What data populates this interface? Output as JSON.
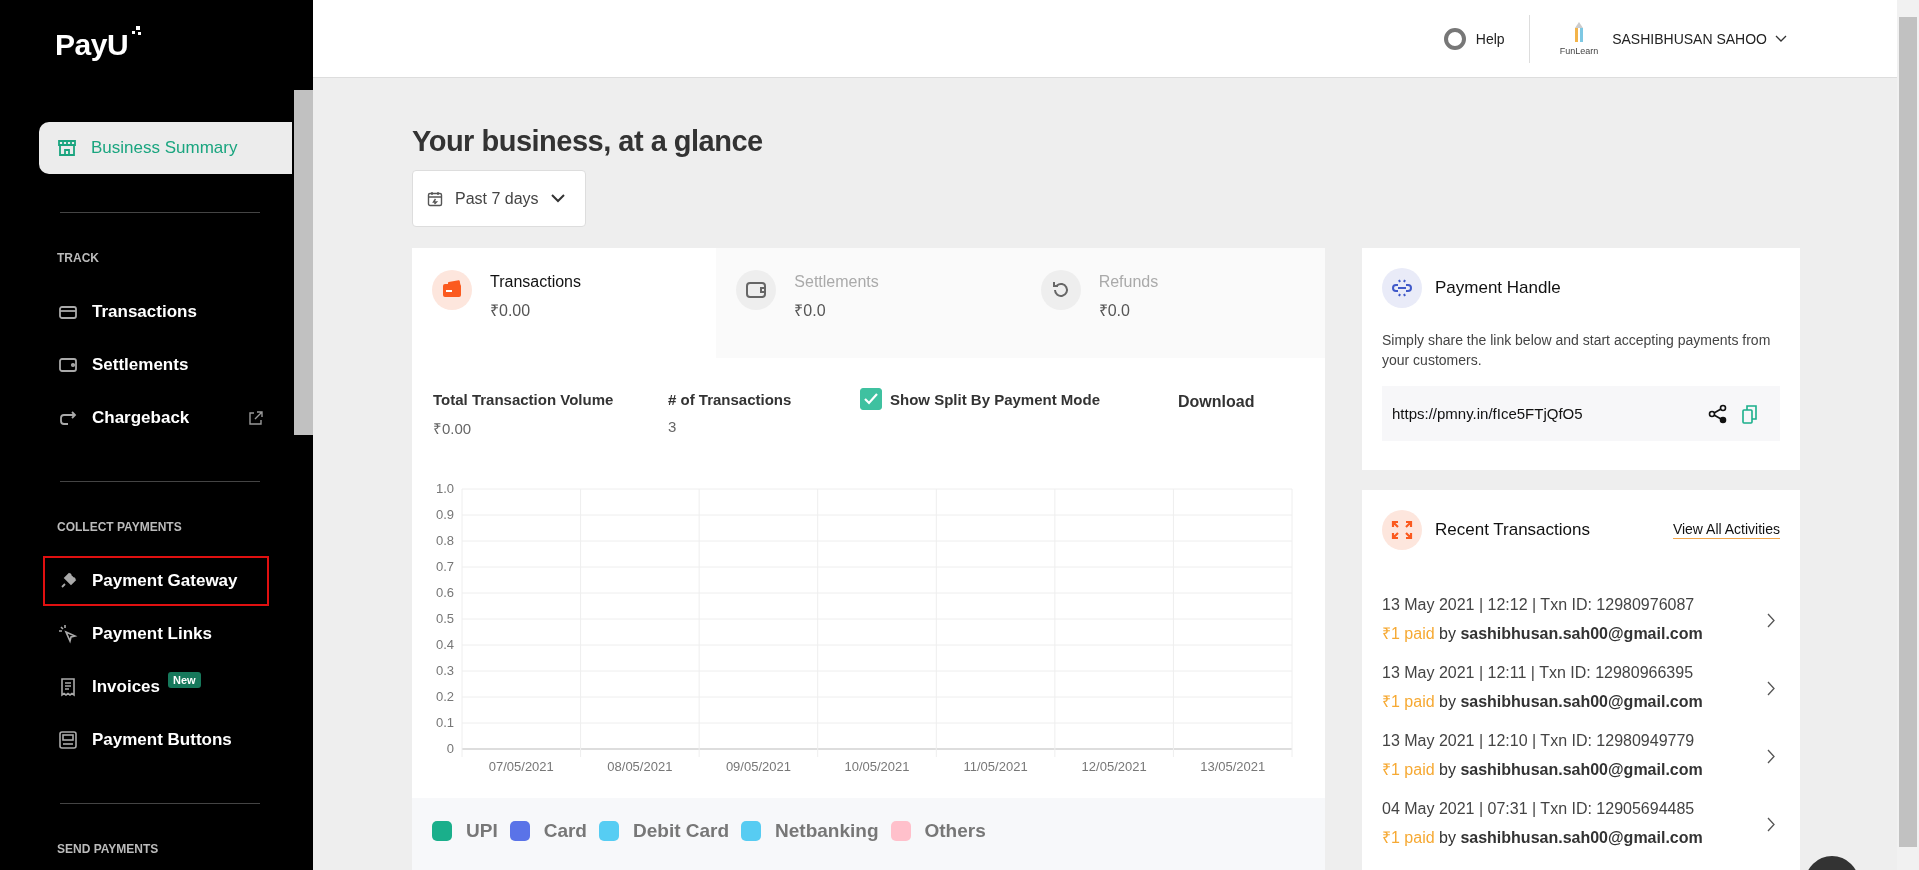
{
  "sidebar": {
    "logo": "PayU",
    "top_item": {
      "label": "Business Summary",
      "selected": true
    },
    "sections": [
      {
        "title": "TRACK",
        "items": [
          {
            "label": "Transactions",
            "selected": false,
            "highlighted": false,
            "external": false
          },
          {
            "label": "Settlements",
            "selected": false,
            "highlighted": false,
            "external": false
          },
          {
            "label": "Chargeback",
            "selected": false,
            "highlighted": false,
            "external": true
          }
        ]
      },
      {
        "title": "COLLECT PAYMENTS",
        "items": [
          {
            "label": "Payment Gateway",
            "selected": false,
            "highlighted": true,
            "external": false
          },
          {
            "label": "Payment Links",
            "selected": false,
            "highlighted": false,
            "external": false
          },
          {
            "label": "Invoices",
            "selected": false,
            "highlighted": false,
            "external": false,
            "badge": "New"
          },
          {
            "label": "Payment Buttons",
            "selected": false,
            "highlighted": false,
            "external": false
          }
        ]
      },
      {
        "title": "SEND PAYMENTS"
      }
    ]
  },
  "header": {
    "help": "Help",
    "account": {
      "logo_caption": "FunLearn",
      "name": "SASHIBHUSAN SAHOO"
    }
  },
  "main": {
    "title": "Your business, at a glance",
    "period": "Past 7 days",
    "stat_tabs": [
      {
        "label": "Transactions",
        "value": "₹0.00",
        "selected": true
      },
      {
        "label": "Settlements",
        "value": "₹0.0",
        "selected": false
      },
      {
        "label": "Refunds",
        "value": "₹0.0",
        "selected": false
      }
    ],
    "metrics": [
      {
        "label": "Total Transaction Volume",
        "value": "₹0.00"
      },
      {
        "label": "# of Transactions",
        "value": "3"
      }
    ],
    "split_toggle": {
      "label": "Show Split By Payment Mode",
      "checked": true
    },
    "download": "Download",
    "chart_data": {
      "type": "bar",
      "categories": [
        "07/05/2021",
        "08/05/2021",
        "09/05/2021",
        "10/05/2021",
        "11/05/2021",
        "12/05/2021",
        "13/05/2021"
      ],
      "ylim": [
        0,
        1
      ],
      "yticks": [
        0,
        {
          "value": 0.1,
          "label": "0.1"
        },
        {
          "value": 0.2,
          "label": "0.2"
        },
        {
          "value": 0.3,
          "label": "0.3"
        },
        {
          "value": 0.4,
          "label": "0.4"
        },
        {
          "value": 0.5,
          "label": "0.5"
        },
        {
          "value": 0.6,
          "label": "0.6"
        },
        {
          "value": 0.7,
          "label": "0.7"
        },
        {
          "value": 0.8,
          "label": "0.8"
        },
        {
          "value": 0.9,
          "label": "0.9"
        },
        {
          "value": 1,
          "label": "1.0"
        }
      ],
      "grid": true,
      "series": [
        {
          "name": "UPI",
          "color": "#1aaf8b",
          "values": [
            null,
            null,
            null,
            null,
            null,
            null,
            null
          ]
        },
        {
          "name": "Card",
          "color": "#5a73e8",
          "values": [
            null,
            null,
            null,
            null,
            null,
            null,
            null
          ]
        },
        {
          "name": "Debit Card",
          "color": "#56cdf3",
          "values": [
            null,
            null,
            null,
            null,
            null,
            null,
            null
          ]
        },
        {
          "name": "Netbanking",
          "color": "#57ccf2",
          "values": [
            null,
            null,
            null,
            null,
            null,
            null,
            null
          ]
        },
        {
          "name": "Others",
          "color": "#ffc0cb",
          "values": [
            null,
            null,
            null,
            null,
            null,
            null,
            null
          ]
        }
      ]
    }
  },
  "payment_handle": {
    "title": "Payment Handle",
    "description": "Simply share the link below and start accepting payments from your customers.",
    "link": "https://pmny.in/fIce5FTjQfO5"
  },
  "recent": {
    "title": "Recent Transactions",
    "view_all": "View All Activities",
    "items": [
      {
        "meta": "13 May 2021 | 12:12 | Txn ID: 12980976087",
        "amount": "₹1 paid",
        "payer": "by **sashibhusan.sah00@gmail.com**"
      },
      {
        "meta": "13 May 2021 | 12:11 | Txn ID: 12980966395",
        "amount": "₹1 paid",
        "payer": "by **sashibhusan.sah00@gmail.com**"
      },
      {
        "meta": "13 May 2021 | 12:10 | Txn ID: 12980949779",
        "amount": "₹1 paid",
        "payer": "by **sashibhusan.sah00@gmail.com**"
      },
      {
        "meta": "04 May 2021 | 07:31 | Txn ID: 12905694485",
        "amount": "₹1 paid",
        "payer": "by **sashibhusan.sah00@gmail.com**"
      }
    ]
  }
}
